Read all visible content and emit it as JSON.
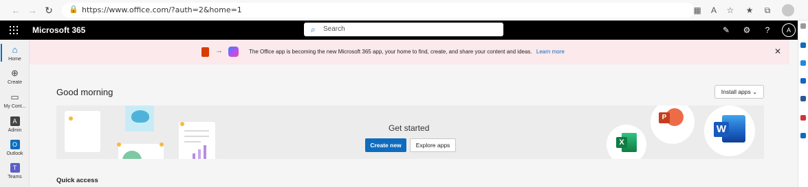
{
  "browser": {
    "url": "https://www.office.com/?auth=2&home=1",
    "back_icon": "arrow-left-icon",
    "forward_icon": "arrow-right-icon",
    "reload_icon": "reload-icon"
  },
  "suite": {
    "app_title": "Microsoft 365",
    "search_placeholder": "Search",
    "avatar_initial": "A"
  },
  "left_rail": {
    "items": [
      {
        "label": "Home",
        "icon": "home-icon"
      },
      {
        "label": "Create",
        "icon": "plus-circle-icon"
      },
      {
        "label": "My Cont...",
        "icon": "folder-icon"
      },
      {
        "label": "Admin",
        "icon": "admin-icon"
      },
      {
        "label": "Outlook",
        "icon": "outlook-icon"
      },
      {
        "label": "Teams",
        "icon": "teams-icon"
      }
    ]
  },
  "banner": {
    "text": "The Office app is becoming the new Microsoft 365 app, your home to find, create, and share your content and ideas.",
    "link": "Learn more"
  },
  "main": {
    "greeting": "Good morning",
    "install_apps": "Install apps",
    "hero_title": "Get started",
    "create_new": "Create new",
    "explore_apps": "Explore apps",
    "quick_access": "Quick access"
  },
  "colors": {
    "accent": "#0f6cbd",
    "banner_bg": "#fbe9ec",
    "suite_bar": "#000000"
  }
}
